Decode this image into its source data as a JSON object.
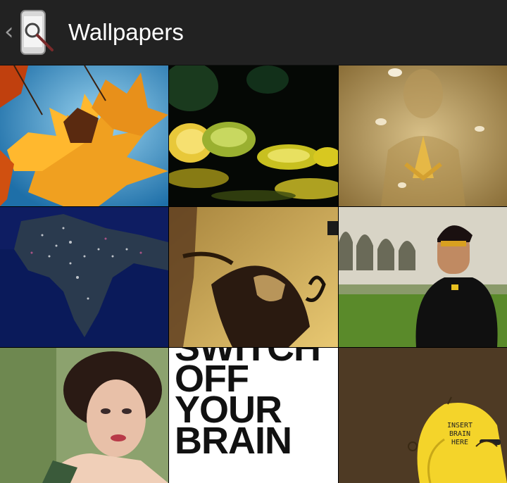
{
  "action_bar": {
    "title": "Wallpapers",
    "up_icon": "chevron-left-icon",
    "app_icon": "phone-search-icon"
  },
  "colors": {
    "action_bar_bg": "#222222",
    "title_text": "#ffffff",
    "grid_bg": "#000000"
  },
  "wallpapers": [
    {
      "subject": "autumn-maple-leaves"
    },
    {
      "subject": "glass-lily-pads"
    },
    {
      "subject": "golden-meditation-figure"
    },
    {
      "subject": "india-night-lights-map"
    },
    {
      "subject": "warrior-on-horse-poster"
    },
    {
      "subject": "man-in-black-jacket-with-arches"
    },
    {
      "subject": "vintage-portrait-woman"
    },
    {
      "subject": "switch-off-your-brain-poster",
      "text": "SWITCH\nOFF\nYOUR\nBRAIN"
    },
    {
      "subject": "cartoon-insert-brain-here",
      "text": "INSERT BRAIN HERE"
    }
  ]
}
